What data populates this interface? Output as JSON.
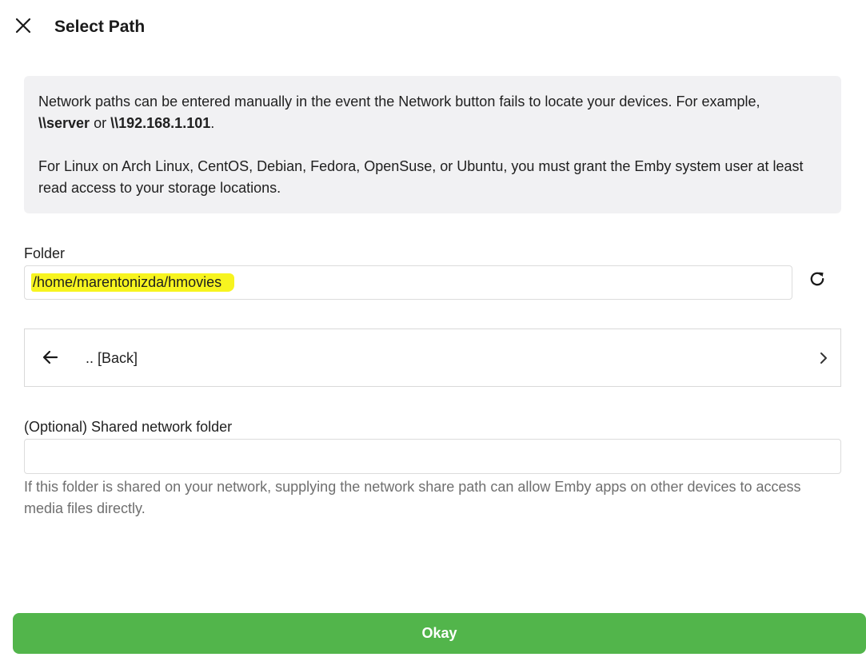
{
  "header": {
    "title": "Select Path",
    "close_icon": "close-icon"
  },
  "info": {
    "para1_text": "Network paths can be entered manually in the event the Network button fails to locate your devices. For example,",
    "para1_example1": "\\\\server",
    "para1_or": "or",
    "para1_example2": "\\\\192.168.1.101",
    "para1_end": ".",
    "para2": "For Linux on Arch Linux, CentOS, Debian, Fedora, OpenSuse, or Ubuntu, you must grant the Emby system user at least read access to your storage locations."
  },
  "folder": {
    "label": "Folder",
    "value": "/home/marentonizda/hmovies",
    "highlight_color": "#f7f41f",
    "refresh_icon": "refresh-icon"
  },
  "browser": {
    "items": [
      {
        "label": ".. [Back]",
        "icon": "arrow-left-icon",
        "trailing_icon": "chevron-right-icon"
      }
    ]
  },
  "network_share": {
    "label": "(Optional) Shared network folder",
    "value": "",
    "help": "If this folder is shared on your network, supplying the network share path can allow Emby apps on other devices to access media files directly."
  },
  "actions": {
    "okay_label": "Okay",
    "okay_color": "#52b54b"
  }
}
